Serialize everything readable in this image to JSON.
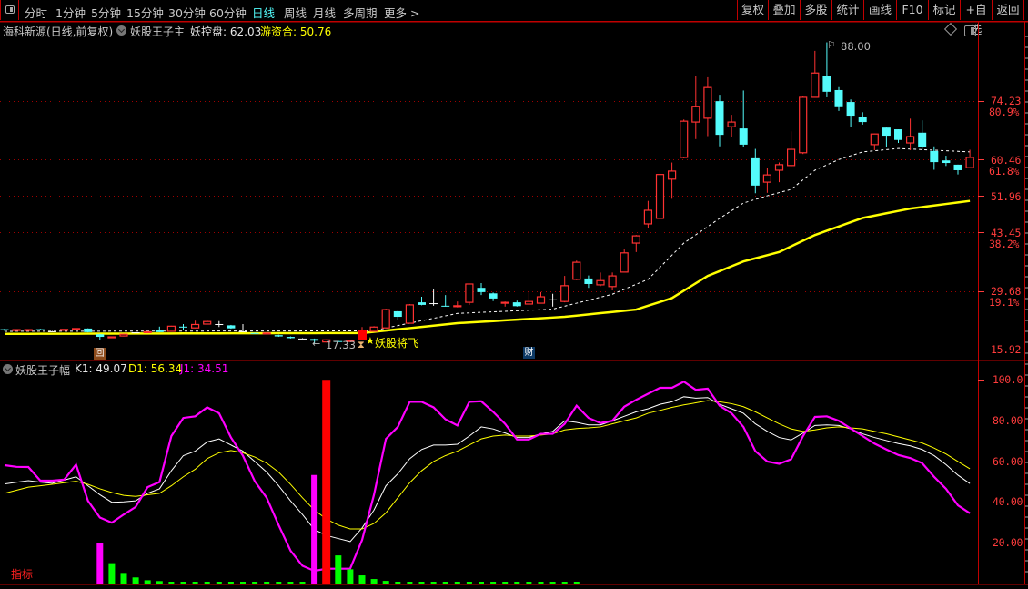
{
  "toolbar": {
    "tabs": [
      "分时",
      "1分钟",
      "5分钟",
      "15分钟",
      "30分钟",
      "60分钟",
      "日线",
      "周线",
      "月线",
      "多周期",
      "更多 >"
    ],
    "active_tab": "日线",
    "buttons": [
      "复权",
      "叠加",
      "多股",
      "统计",
      "画线",
      "F10",
      "标记",
      "+自选",
      "返回"
    ]
  },
  "main_header": {
    "stock": "海科新源(日线,前复权)",
    "indicator": "妖股王子主",
    "ykp_label": "妖控盘: 62.03",
    "yzh_label": "游资合: 50.76"
  },
  "price_axis": {
    "labels": [
      "74.23",
      "80.9%",
      "60.46",
      "61.8%",
      "51.96",
      "43.45",
      "38.2%",
      "29.68",
      "19.1%",
      "15.92"
    ]
  },
  "annotations": {
    "high": "88.00",
    "low": "17.33",
    "signal": "妖股将飞",
    "event_hui": "回",
    "event_cai": "财"
  },
  "sub_header": {
    "indicator": "妖股王子幅",
    "k1": "K1: 49.07",
    "d1": "D1: 56.34",
    "j1": "J1: 34.51"
  },
  "sub_axis": {
    "labels": [
      "100.0",
      "80.00",
      "60.00",
      "40.00",
      "20.00"
    ]
  },
  "footer_label": "指标",
  "colors": {
    "up": "#ff3232",
    "down": "#54fcfc",
    "doji": "#ffffff",
    "ma_slow": "#ffff00",
    "ma_fast": "#ffffff",
    "k": "#ffffff",
    "d": "#ffff00",
    "j": "#ff00ff",
    "grid": "#a00000",
    "green": "#00ff00",
    "red": "#ff0000",
    "magenta": "#ff00ff"
  },
  "chart_data": [
    {
      "type": "candlestick",
      "title": "海科新源 日线 前复权",
      "ylim": [
        15.92,
        88.0
      ],
      "gridlines": [
        74.23,
        60.46,
        51.96,
        43.45,
        29.68
      ],
      "signal_index": 30,
      "ohlc": [
        [
          20.7,
          20.8,
          20.3,
          20.5
        ],
        [
          20.5,
          20.7,
          20.4,
          20.6
        ],
        [
          20.5,
          20.7,
          20.4,
          20.6
        ],
        [
          20.7,
          20.8,
          20.4,
          20.5
        ],
        [
          20.2,
          20.3,
          20.1,
          20.2
        ],
        [
          20.5,
          20.7,
          20.4,
          20.65
        ],
        [
          20.6,
          20.9,
          20.5,
          20.85
        ],
        [
          20.85,
          20.9,
          19.95,
          20.0
        ],
        [
          19.5,
          19.6,
          18.2,
          18.9
        ],
        [
          18.7,
          18.95,
          18.6,
          18.9
        ],
        [
          19.1,
          19.6,
          19.0,
          19.5
        ],
        [
          19.95,
          20.0,
          19.9,
          19.95
        ],
        [
          19.9,
          20.2,
          19.8,
          20.1
        ],
        [
          20.4,
          21.3,
          20.0,
          20.0
        ],
        [
          20.2,
          21.5,
          20.1,
          21.4
        ],
        [
          21.3,
          21.9,
          20.4,
          21.2
        ],
        [
          21.0,
          22.7,
          20.9,
          21.8
        ],
        [
          21.9,
          22.8,
          21.8,
          22.5
        ],
        [
          21.9,
          22.6,
          21.2,
          21.85
        ],
        [
          21.6,
          21.7,
          20.8,
          20.9
        ],
        [
          20.2,
          21.9,
          20.2,
          20.2
        ],
        [
          19.8,
          19.9,
          19.7,
          19.7
        ],
        [
          19.6,
          19.8,
          19.5,
          19.8
        ],
        [
          19.3,
          19.4,
          18.9,
          19.0
        ],
        [
          18.9,
          19.0,
          18.5,
          18.6
        ],
        [
          18.5,
          18.6,
          18.4,
          18.45
        ],
        [
          18.4,
          18.5,
          17.33,
          18.0
        ],
        [
          17.7,
          18.3,
          17.6,
          18.2
        ],
        [
          17.9,
          18.0,
          17.7,
          17.8
        ],
        [
          17.9,
          18.1,
          17.8,
          18.0
        ],
        [
          18.2,
          21.2,
          18.1,
          20.4
        ],
        [
          20.2,
          21.4,
          20.1,
          21.2
        ],
        [
          21.0,
          25.5,
          20.9,
          25.3
        ],
        [
          24.9,
          25.0,
          22.9,
          23.6
        ],
        [
          22.1,
          26.6,
          22.0,
          26.4
        ],
        [
          27.0,
          28.3,
          26.3,
          26.4
        ],
        [
          26.8,
          30.0,
          26.2,
          26.8
        ],
        [
          26.2,
          28.7,
          26.0,
          26.0
        ],
        [
          26.0,
          27.2,
          25.8,
          26.2
        ],
        [
          27.0,
          31.4,
          26.4,
          31.3
        ],
        [
          30.4,
          31.5,
          28.7,
          29.4
        ],
        [
          29.1,
          29.3,
          27.3,
          27.9
        ],
        [
          26.8,
          27.2,
          26.0,
          27.0
        ],
        [
          27.0,
          27.4,
          26.0,
          26.1
        ],
        [
          26.6,
          29.4,
          26.5,
          27.2
        ],
        [
          26.8,
          29.4,
          26.7,
          28.3
        ],
        [
          27.7,
          29.0,
          26.0,
          27.7
        ],
        [
          27.2,
          33.2,
          27.0,
          30.9
        ],
        [
          32.4,
          36.8,
          32.2,
          36.4
        ],
        [
          32.6,
          33.3,
          30.4,
          31.3
        ],
        [
          31.1,
          34.0,
          30.8,
          32.1
        ],
        [
          30.7,
          34.0,
          29.8,
          33.2
        ],
        [
          34.1,
          39.4,
          34.0,
          38.6
        ],
        [
          40.9,
          42.8,
          38.8,
          42.6
        ],
        [
          45.4,
          50.8,
          44.4,
          48.6
        ],
        [
          46.7,
          57.9,
          46.5,
          57.0
        ],
        [
          55.9,
          59.8,
          51.3,
          57.8
        ],
        [
          61.0,
          69.9,
          60.8,
          69.5
        ],
        [
          69.3,
          80.2,
          65.3,
          73.0
        ],
        [
          70.2,
          79.8,
          66.0,
          77.4
        ],
        [
          74.2,
          75.7,
          63.6,
          66.3
        ],
        [
          68.2,
          71.0,
          65.7,
          69.3
        ],
        [
          67.8,
          76.7,
          63.4,
          64.0
        ],
        [
          60.8,
          63.0,
          52.6,
          54.4
        ],
        [
          55.2,
          58.6,
          52.7,
          56.9
        ],
        [
          58.0,
          59.8,
          55.2,
          59.3
        ],
        [
          59.1,
          67.1,
          58.9,
          62.9
        ],
        [
          62.1,
          75.3,
          61.8,
          75.1
        ],
        [
          75.1,
          86.0,
          75.0,
          80.8
        ],
        [
          80.2,
          88.0,
          75.1,
          76.4
        ],
        [
          76.8,
          77.5,
          71.9,
          73.0
        ],
        [
          74.0,
          74.6,
          68.2,
          70.8
        ],
        [
          70.6,
          71.6,
          68.7,
          69.3
        ],
        [
          64.0,
          66.6,
          62.7,
          66.5
        ],
        [
          68.0,
          68.0,
          63.4,
          66.1
        ],
        [
          67.6,
          67.6,
          64.4,
          65.1
        ],
        [
          64.4,
          70.1,
          62.7,
          65.9
        ],
        [
          66.8,
          69.7,
          63.0,
          63.5
        ],
        [
          62.5,
          63.6,
          58.1,
          59.9
        ],
        [
          60.3,
          61.4,
          59.0,
          59.7
        ],
        [
          59.3,
          59.3,
          57.0,
          58.0
        ],
        [
          58.6,
          62.8,
          58.5,
          61.0
        ]
      ],
      "ma_fast": [
        [
          0,
          20.2
        ],
        [
          30,
          20.3
        ],
        [
          31,
          20.4
        ],
        [
          38,
          24.4
        ],
        [
          46,
          25.4
        ],
        [
          51,
          28.9
        ],
        [
          54,
          32.4
        ],
        [
          57,
          40.9
        ],
        [
          60,
          46.7
        ],
        [
          62,
          50.3
        ],
        [
          64,
          52.0
        ],
        [
          66,
          53.5
        ],
        [
          68,
          58.0
        ],
        [
          70,
          60.5
        ],
        [
          72,
          62.3
        ],
        [
          75,
          63.1
        ],
        [
          78,
          62.7
        ],
        [
          81,
          62.3
        ]
      ],
      "ma_slow": [
        [
          0,
          19.6
        ],
        [
          30,
          19.8
        ],
        [
          38,
          22.1
        ],
        [
          47,
          23.6
        ],
        [
          53,
          25.3
        ],
        [
          56,
          28.0
        ],
        [
          59,
          33.2
        ],
        [
          62,
          36.6
        ],
        [
          65,
          38.8
        ],
        [
          68,
          42.8
        ],
        [
          72,
          46.8
        ],
        [
          76,
          49.0
        ],
        [
          81,
          50.8
        ]
      ]
    },
    {
      "type": "line",
      "title": "妖股王子幅",
      "ylim": [
        0,
        100
      ],
      "gridlines": [
        80,
        60,
        40,
        20
      ],
      "series": [
        {
          "name": "K1",
          "values": [
            48.9,
            49.7,
            50.5,
            49.8,
            49.2,
            50.8,
            52.4,
            48,
            43.6,
            39.9,
            40.1,
            40.6,
            44.3,
            46.5,
            55.4,
            62.8,
            65,
            69.5,
            71,
            68,
            65,
            59.9,
            54.7,
            48,
            40.6,
            33.9,
            26.5,
            23.6,
            22.1,
            20.6,
            27.3,
            36.1,
            48,
            53.9,
            61.3,
            65.8,
            68,
            68,
            68.4,
            72.4,
            76.9,
            75.9,
            73.9,
            71.7,
            71.7,
            73.5,
            74.7,
            79.9,
            79.1,
            77.9,
            77.9,
            79.9,
            82.1,
            84.3,
            85.8,
            88,
            89.2,
            91.7,
            91,
            91.3,
            88,
            85.8,
            83.6,
            78.4,
            74.7,
            71.7,
            70.5,
            73.9,
            77.6,
            77.9,
            77.6,
            75.9,
            73.5,
            71.7,
            70.2,
            68.7,
            67.6,
            65.8,
            62.8,
            58.4,
            53.2,
            49.07
          ]
        },
        {
          "name": "D1",
          "values": [
            44.3,
            45.8,
            47.3,
            48.0,
            48.7,
            49.5,
            50.2,
            48.7,
            46.5,
            44.7,
            43.3,
            42.8,
            43.6,
            44.3,
            48,
            52.4,
            56.1,
            61.3,
            64.2,
            65.3,
            64.2,
            62.1,
            59.1,
            54.7,
            48.7,
            42.1,
            36.1,
            31.7,
            28.7,
            26.8,
            26.8,
            29.5,
            34.7,
            42.1,
            49.5,
            55.4,
            59.9,
            62.8,
            65,
            68,
            71,
            72.4,
            72.9,
            72.4,
            72.4,
            72.9,
            73.5,
            75.4,
            76.1,
            76.4,
            76.9,
            78.4,
            79.9,
            81.3,
            83.6,
            85,
            86.5,
            87.7,
            88.7,
            89.8,
            89.2,
            88.3,
            86.8,
            84.3,
            81.3,
            78.4,
            75.9,
            74.7,
            75.4,
            76.4,
            76.9,
            76.4,
            75.9,
            74.7,
            73.5,
            72,
            70.5,
            69,
            66.5,
            63.6,
            59.9,
            56.34
          ]
        },
        {
          "name": "J1",
          "values": [
            58.1,
            57.3,
            57.2,
            50.5,
            50.5,
            51.0,
            58.4,
            40.6,
            32.4,
            29.9,
            33.9,
            37.6,
            47.3,
            49.8,
            72.4,
            81.3,
            82.1,
            86.5,
            83.6,
            71.7,
            62.8,
            50.2,
            42.1,
            28.7,
            16.1,
            8.7,
            6.2,
            7.3,
            7.3,
            7.3,
            21.4,
            43.6,
            71.0,
            76.9,
            89.2,
            89.2,
            86.5,
            80.6,
            77.6,
            89.2,
            89.5,
            84.3,
            78.4,
            70.7,
            70.7,
            73.5,
            73.5,
            78.4,
            87.3,
            81.3,
            78.8,
            79.9,
            86.8,
            90.2,
            93.2,
            96.1,
            96.1,
            99.1,
            95.1,
            95.7,
            87.3,
            83.6,
            76.9,
            65.0,
            59.9,
            58.8,
            61.0,
            72.4,
            81.8,
            82.1,
            79.9,
            76.1,
            72.4,
            68.7,
            65.8,
            63.1,
            61.6,
            59.1,
            52.4,
            46.5,
            38.4,
            34.51
          ]
        }
      ],
      "bars": [
        [
          8,
          20,
          "magenta"
        ],
        [
          9,
          10,
          "green"
        ],
        [
          10,
          5.2,
          "green"
        ],
        [
          11,
          3,
          "green"
        ],
        [
          12,
          1.6,
          "green"
        ],
        [
          13,
          1.2,
          "green"
        ],
        [
          14,
          0.6,
          "green"
        ],
        [
          15,
          0.6,
          "green"
        ],
        [
          16,
          0.5,
          "green"
        ],
        [
          17,
          0.5,
          "green"
        ],
        [
          18,
          0.5,
          "green"
        ],
        [
          19,
          0.5,
          "green"
        ],
        [
          20,
          0.4,
          "green"
        ],
        [
          21,
          0.4,
          "green"
        ],
        [
          22,
          0.4,
          "green"
        ],
        [
          23,
          0.4,
          "green"
        ],
        [
          24,
          0.4,
          "green"
        ],
        [
          25,
          0.4,
          "green"
        ],
        [
          26,
          53.3,
          "magenta"
        ],
        [
          27,
          100,
          "red"
        ],
        [
          28,
          13.8,
          "green"
        ],
        [
          29,
          7,
          "green"
        ],
        [
          30,
          4,
          "green"
        ],
        [
          31,
          2.2,
          "green"
        ],
        [
          32,
          1.3,
          "green"
        ],
        [
          33,
          0.7,
          "green"
        ],
        [
          34,
          0.7,
          "green"
        ],
        [
          35,
          0.6,
          "green"
        ],
        [
          36,
          0.6,
          "green"
        ],
        [
          37,
          0.6,
          "green"
        ],
        [
          38,
          0.6,
          "green"
        ],
        [
          39,
          0.6,
          "green"
        ],
        [
          40,
          0.6,
          "green"
        ],
        [
          41,
          0.5,
          "green"
        ],
        [
          42,
          0.4,
          "green"
        ],
        [
          43,
          0.4,
          "green"
        ],
        [
          44,
          0.4,
          "green"
        ],
        [
          45,
          0.4,
          "green"
        ],
        [
          46,
          0.4,
          "green"
        ],
        [
          47,
          0.4,
          "green"
        ],
        [
          48,
          0.4,
          "green"
        ]
      ]
    }
  ]
}
